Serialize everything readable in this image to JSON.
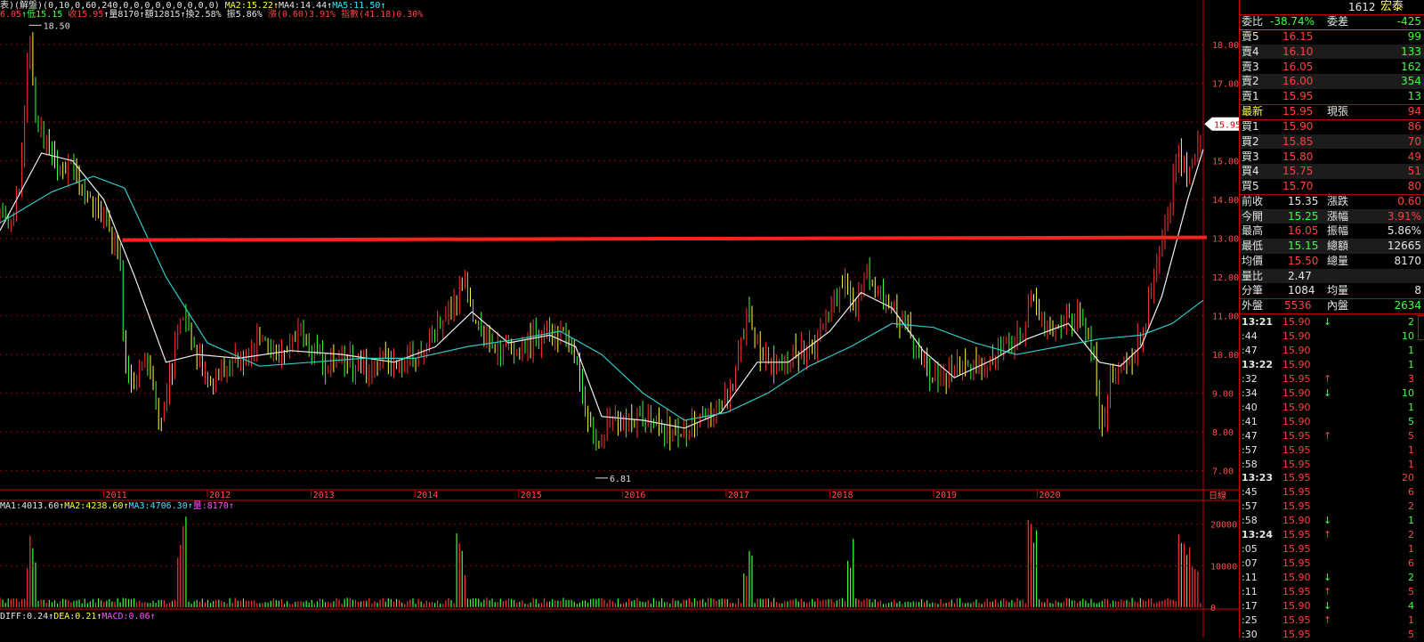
{
  "header": {
    "kline_items": [
      {
        "text": "6.05",
        "color": "red"
      },
      {
        "text": "↑低15.15",
        "color": "grn"
      },
      {
        "text": " 收15.95",
        "color": "red"
      },
      {
        "text": "↑量8170",
        "color": "wht"
      },
      {
        "text": "↑額12815",
        "color": "wht"
      },
      {
        "text": "↑換2.58%",
        "color": "wht"
      },
      {
        "text": " 振5.86%",
        "color": "wht"
      },
      {
        "text": " 漲(0.60)3.91%",
        "color": "red"
      },
      {
        "text": " 指數(41.18)0.30%",
        "color": "red"
      }
    ],
    "ma_line": "表)(解盤)(0,10,0,60,240,0,0,0,0,0,0,0,0,0)",
    "ma_items": [
      {
        "text": " MA2:15.22↑",
        "color": "yel"
      },
      {
        "text": "MA4:14.44↑",
        "color": "wht"
      },
      {
        "text": "MA5:11.50↑",
        "color": "cyn"
      }
    ],
    "vol_items": [
      {
        "text": "MA1:4013.60↑",
        "color": "wht"
      },
      {
        "text": "MA2:4238.60↑",
        "color": "yel"
      },
      {
        "text": "MA3:4706.30↑",
        "color": "cyn"
      },
      {
        "text": "量:8170↑",
        "color": "mag"
      }
    ],
    "macd_items": [
      {
        "text": "DIFF:0.24↑",
        "color": "wht"
      },
      {
        "text": "DEA:0.21↑",
        "color": "yel"
      },
      {
        "text": "MACD:0.06↑",
        "color": "mag"
      }
    ]
  },
  "chart_data": [
    {
      "type": "candlestick",
      "ylim": [
        6.6,
        18.6
      ],
      "y_ticks": [
        "18.00",
        "17.00",
        "16.00",
        "15.00",
        "14.00",
        "13.00",
        "12.00",
        "11.00",
        "10.00",
        "9.00",
        "8.00",
        "7.00"
      ],
      "x_labels": [
        "2011",
        "2012",
        "2013",
        "2014",
        "2015",
        "2016",
        "2017",
        "2018",
        "2019",
        "2020"
      ],
      "period_label": "日線",
      "current_price_label": "15.95",
      "high_annotation": "18.50",
      "low_annotation": "6.81",
      "resistance_line": 13.0,
      "close_path": [
        [
          2010.0,
          13.6
        ],
        [
          2010.1,
          13.2
        ],
        [
          2010.2,
          14.6
        ],
        [
          2010.28,
          18.5
        ],
        [
          2010.35,
          16.0
        ],
        [
          2010.45,
          15.6
        ],
        [
          2010.55,
          14.6
        ],
        [
          2010.7,
          14.8
        ],
        [
          2010.85,
          13.9
        ],
        [
          2011.0,
          13.5
        ],
        [
          2011.08,
          13.0
        ],
        [
          2011.15,
          12.6
        ],
        [
          2011.2,
          10.0
        ],
        [
          2011.28,
          9.2
        ],
        [
          2011.38,
          9.6
        ],
        [
          2011.48,
          9.4
        ],
        [
          2011.55,
          8.2
        ],
        [
          2011.65,
          9.5
        ],
        [
          2011.75,
          11.2
        ],
        [
          2011.85,
          10.3
        ],
        [
          2011.95,
          9.6
        ],
        [
          2012.1,
          9.4
        ],
        [
          2012.3,
          9.9
        ],
        [
          2012.5,
          10.3
        ],
        [
          2012.7,
          9.9
        ],
        [
          2012.9,
          10.6
        ],
        [
          2013.1,
          9.8
        ],
        [
          2013.3,
          9.9
        ],
        [
          2013.5,
          9.6
        ],
        [
          2013.7,
          9.9
        ],
        [
          2013.9,
          9.7
        ],
        [
          2014.1,
          10.2
        ],
        [
          2014.25,
          10.9
        ],
        [
          2014.4,
          11.5
        ],
        [
          2014.48,
          12.1
        ],
        [
          2014.55,
          11.1
        ],
        [
          2014.65,
          10.6
        ],
        [
          2014.8,
          10.1
        ],
        [
          2015.0,
          10.2
        ],
        [
          2015.15,
          10.4
        ],
        [
          2015.3,
          10.6
        ],
        [
          2015.45,
          10.6
        ],
        [
          2015.55,
          9.7
        ],
        [
          2015.62,
          9.0
        ],
        [
          2015.7,
          7.9
        ],
        [
          2015.75,
          7.6
        ],
        [
          2015.9,
          8.4
        ],
        [
          2016.0,
          8.4
        ],
        [
          2016.15,
          8.3
        ],
        [
          2016.3,
          8.3
        ],
        [
          2016.5,
          8.0
        ],
        [
          2016.7,
          8.3
        ],
        [
          2016.9,
          8.5
        ],
        [
          2017.05,
          9.1
        ],
        [
          2017.2,
          11.0
        ],
        [
          2017.35,
          10.0
        ],
        [
          2017.5,
          9.6
        ],
        [
          2017.7,
          10.1
        ],
        [
          2017.85,
          10.3
        ],
        [
          2018.0,
          11.0
        ],
        [
          2018.15,
          12.0
        ],
        [
          2018.25,
          11.0
        ],
        [
          2018.35,
          12.2
        ],
        [
          2018.45,
          11.6
        ],
        [
          2018.6,
          11.1
        ],
        [
          2018.75,
          10.7
        ],
        [
          2018.9,
          9.9
        ],
        [
          2019.05,
          9.2
        ],
        [
          2019.2,
          9.6
        ],
        [
          2019.4,
          9.8
        ],
        [
          2019.6,
          10.0
        ],
        [
          2019.75,
          10.3
        ],
        [
          2019.85,
          10.6
        ],
        [
          2019.95,
          11.5
        ],
        [
          2020.1,
          10.7
        ],
        [
          2020.3,
          10.9
        ],
        [
          2020.45,
          10.9
        ],
        [
          2020.55,
          9.8
        ],
        [
          2020.62,
          7.9
        ],
        [
          2020.72,
          9.6
        ],
        [
          2020.85,
          9.8
        ],
        [
          2020.95,
          10.1
        ],
        [
          2021.05,
          11.0
        ],
        [
          2021.15,
          12.5
        ],
        [
          2021.25,
          13.6
        ],
        [
          2021.35,
          15.2
        ],
        [
          2021.45,
          14.8
        ],
        [
          2021.55,
          15.5
        ],
        [
          2021.6,
          15.95
        ]
      ],
      "ma2_path": [
        [
          2010.0,
          13.2
        ],
        [
          2010.4,
          15.2
        ],
        [
          2010.7,
          15.0
        ],
        [
          2011.0,
          14.0
        ],
        [
          2011.3,
          12.0
        ],
        [
          2011.6,
          9.8
        ],
        [
          2011.9,
          10.0
        ],
        [
          2012.3,
          9.9
        ],
        [
          2012.8,
          10.1
        ],
        [
          2013.3,
          10.0
        ],
        [
          2013.8,
          9.8
        ],
        [
          2014.2,
          10.2
        ],
        [
          2014.55,
          11.1
        ],
        [
          2014.9,
          10.3
        ],
        [
          2015.3,
          10.5
        ],
        [
          2015.55,
          10.2
        ],
        [
          2015.8,
          8.4
        ],
        [
          2016.2,
          8.3
        ],
        [
          2016.6,
          8.1
        ],
        [
          2016.95,
          8.5
        ],
        [
          2017.3,
          9.8
        ],
        [
          2017.6,
          9.8
        ],
        [
          2018.0,
          10.6
        ],
        [
          2018.3,
          11.6
        ],
        [
          2018.6,
          11.2
        ],
        [
          2018.9,
          10.1
        ],
        [
          2019.2,
          9.4
        ],
        [
          2019.6,
          9.9
        ],
        [
          2019.9,
          10.4
        ],
        [
          2020.3,
          10.8
        ],
        [
          2020.6,
          9.8
        ],
        [
          2020.8,
          9.7
        ],
        [
          2021.0,
          10.2
        ],
        [
          2021.2,
          11.5
        ],
        [
          2021.45,
          14.0
        ],
        [
          2021.6,
          15.3
        ]
      ],
      "ma4_path": [
        [
          2010.0,
          13.4
        ],
        [
          2010.5,
          14.2
        ],
        [
          2010.9,
          14.6
        ],
        [
          2011.2,
          14.3
        ],
        [
          2011.6,
          12.0
        ],
        [
          2012.0,
          10.3
        ],
        [
          2012.5,
          9.7
        ],
        [
          2013.0,
          9.8
        ],
        [
          2013.5,
          9.9
        ],
        [
          2014.0,
          9.9
        ],
        [
          2014.5,
          10.2
        ],
        [
          2015.0,
          10.4
        ],
        [
          2015.4,
          10.6
        ],
        [
          2015.8,
          10.0
        ],
        [
          2016.2,
          9.0
        ],
        [
          2016.6,
          8.3
        ],
        [
          2017.0,
          8.5
        ],
        [
          2017.4,
          9.0
        ],
        [
          2017.8,
          9.7
        ],
        [
          2018.2,
          10.2
        ],
        [
          2018.6,
          10.8
        ],
        [
          2019.0,
          10.7
        ],
        [
          2019.4,
          10.3
        ],
        [
          2019.8,
          10.0
        ],
        [
          2020.2,
          10.2
        ],
        [
          2020.6,
          10.4
        ],
        [
          2021.0,
          10.5
        ],
        [
          2021.3,
          10.8
        ],
        [
          2021.6,
          11.4
        ]
      ]
    },
    {
      "type": "bar",
      "name": "volume",
      "ylim": [
        0,
        24000
      ],
      "y_ticks": [
        "20000",
        "10000",
        "0"
      ]
    }
  ],
  "quote": {
    "code": "1612",
    "name": "宏泰",
    "ratio_label": "委比",
    "ratio_value": "-38.74%",
    "diff_label": "委差",
    "diff_value": "-425",
    "asks": [
      {
        "label": "賣5",
        "price": "16.15",
        "vol": "99"
      },
      {
        "label": "賣4",
        "price": "16.10",
        "vol": "133"
      },
      {
        "label": "賣3",
        "price": "16.05",
        "vol": "162"
      },
      {
        "label": "賣2",
        "price": "16.00",
        "vol": "354"
      },
      {
        "label": "賣1",
        "price": "15.95",
        "vol": "13"
      }
    ],
    "last_label": "最新",
    "last_price": "15.95",
    "now_label": "現張",
    "now_vol": "94",
    "bids": [
      {
        "label": "買1",
        "price": "15.90",
        "vol": "86"
      },
      {
        "label": "買2",
        "price": "15.85",
        "vol": "70"
      },
      {
        "label": "買3",
        "price": "15.80",
        "vol": "49"
      },
      {
        "label": "買4",
        "price": "15.75",
        "vol": "51"
      },
      {
        "label": "買5",
        "price": "15.70",
        "vol": "80"
      }
    ],
    "stats": [
      {
        "l1": "前收",
        "v1": "15.35",
        "c1": "wht",
        "l2": "漲跌",
        "v2": "0.60",
        "c2": "red"
      },
      {
        "l1": "今開",
        "v1": "15.25",
        "c1": "grn",
        "l2": "漲幅",
        "v2": "3.91%",
        "c2": "red"
      },
      {
        "l1": "最高",
        "v1": "16.05",
        "c1": "red",
        "l2": "振幅",
        "v2": "5.86%",
        "c2": "wht"
      },
      {
        "l1": "最低",
        "v1": "15.15",
        "c1": "grn",
        "l2": "總額",
        "v2": "12665",
        "c2": "wht"
      },
      {
        "l1": "均價",
        "v1": "15.50",
        "c1": "red",
        "l2": "總量",
        "v2": "8170",
        "c2": "wht"
      },
      {
        "l1": "量比",
        "v1": "2.47",
        "c1": "wht",
        "l2": "",
        "v2": "",
        "c2": "wht"
      },
      {
        "l1": "分筆",
        "v1": "1084",
        "c1": "wht",
        "l2": "均量",
        "v2": "8",
        "c2": "wht"
      }
    ],
    "outer_label": "外盤",
    "outer_value": "5536",
    "inner_label": "內盤",
    "inner_value": "2634",
    "ticks": [
      {
        "t": "13:21",
        "p": "15.90",
        "a": "↓",
        "v": "2",
        "pc": "red",
        "ac": "grn"
      },
      {
        "t": ":44",
        "p": "15.90",
        "a": "",
        "v": "10",
        "pc": "red",
        "ac": "grn"
      },
      {
        "t": ":47",
        "p": "15.90",
        "a": "",
        "v": "1",
        "pc": "red",
        "ac": "grn"
      },
      {
        "t": "13:22",
        "p": "15.90",
        "a": "",
        "v": "1",
        "pc": "red",
        "ac": "grn"
      },
      {
        "t": ":32",
        "p": "15.95",
        "a": "↑",
        "v": "3",
        "pc": "red",
        "ac": "red"
      },
      {
        "t": ":34",
        "p": "15.90",
        "a": "↓",
        "v": "10",
        "pc": "red",
        "ac": "grn"
      },
      {
        "t": ":40",
        "p": "15.90",
        "a": "",
        "v": "1",
        "pc": "red",
        "ac": "grn"
      },
      {
        "t": ":41",
        "p": "15.90",
        "a": "",
        "v": "5",
        "pc": "red",
        "ac": "grn"
      },
      {
        "t": ":47",
        "p": "15.95",
        "a": "↑",
        "v": "5",
        "pc": "red",
        "ac": "red"
      },
      {
        "t": ":57",
        "p": "15.95",
        "a": "",
        "v": "1",
        "pc": "red",
        "ac": "red"
      },
      {
        "t": ":58",
        "p": "15.95",
        "a": "",
        "v": "1",
        "pc": "red",
        "ac": "red"
      },
      {
        "t": "13:23",
        "p": "15.95",
        "a": "",
        "v": "20",
        "pc": "red",
        "ac": "red"
      },
      {
        "t": ":45",
        "p": "15.95",
        "a": "",
        "v": "6",
        "pc": "red",
        "ac": "red"
      },
      {
        "t": ":57",
        "p": "15.95",
        "a": "",
        "v": "2",
        "pc": "red",
        "ac": "red"
      },
      {
        "t": ":58",
        "p": "15.90",
        "a": "↓",
        "v": "1",
        "pc": "red",
        "ac": "grn"
      },
      {
        "t": "13:24",
        "p": "15.95",
        "a": "↑",
        "v": "2",
        "pc": "red",
        "ac": "red"
      },
      {
        "t": ":05",
        "p": "15.95",
        "a": "",
        "v": "1",
        "pc": "red",
        "ac": "red"
      },
      {
        "t": ":07",
        "p": "15.95",
        "a": "",
        "v": "6",
        "pc": "red",
        "ac": "red"
      },
      {
        "t": ":11",
        "p": "15.90",
        "a": "↓",
        "v": "2",
        "pc": "red",
        "ac": "grn"
      },
      {
        "t": ":11",
        "p": "15.95",
        "a": "↑",
        "v": "5",
        "pc": "red",
        "ac": "red"
      },
      {
        "t": ":17",
        "p": "15.90",
        "a": "↓",
        "v": "4",
        "pc": "red",
        "ac": "grn"
      },
      {
        "t": ":25",
        "p": "15.95",
        "a": "↑",
        "v": "1",
        "pc": "red",
        "ac": "red"
      },
      {
        "t": ":30",
        "p": "15.95",
        "a": "",
        "v": "5",
        "pc": "red",
        "ac": "red"
      }
    ]
  },
  "colors": {
    "up": "#ff3232",
    "down": "#00e4e4",
    "green": "#3cff3c",
    "yellow": "#ffff40",
    "cyan": "#40e0ff",
    "grid": "#8b0000",
    "trend": "#ff2020"
  }
}
